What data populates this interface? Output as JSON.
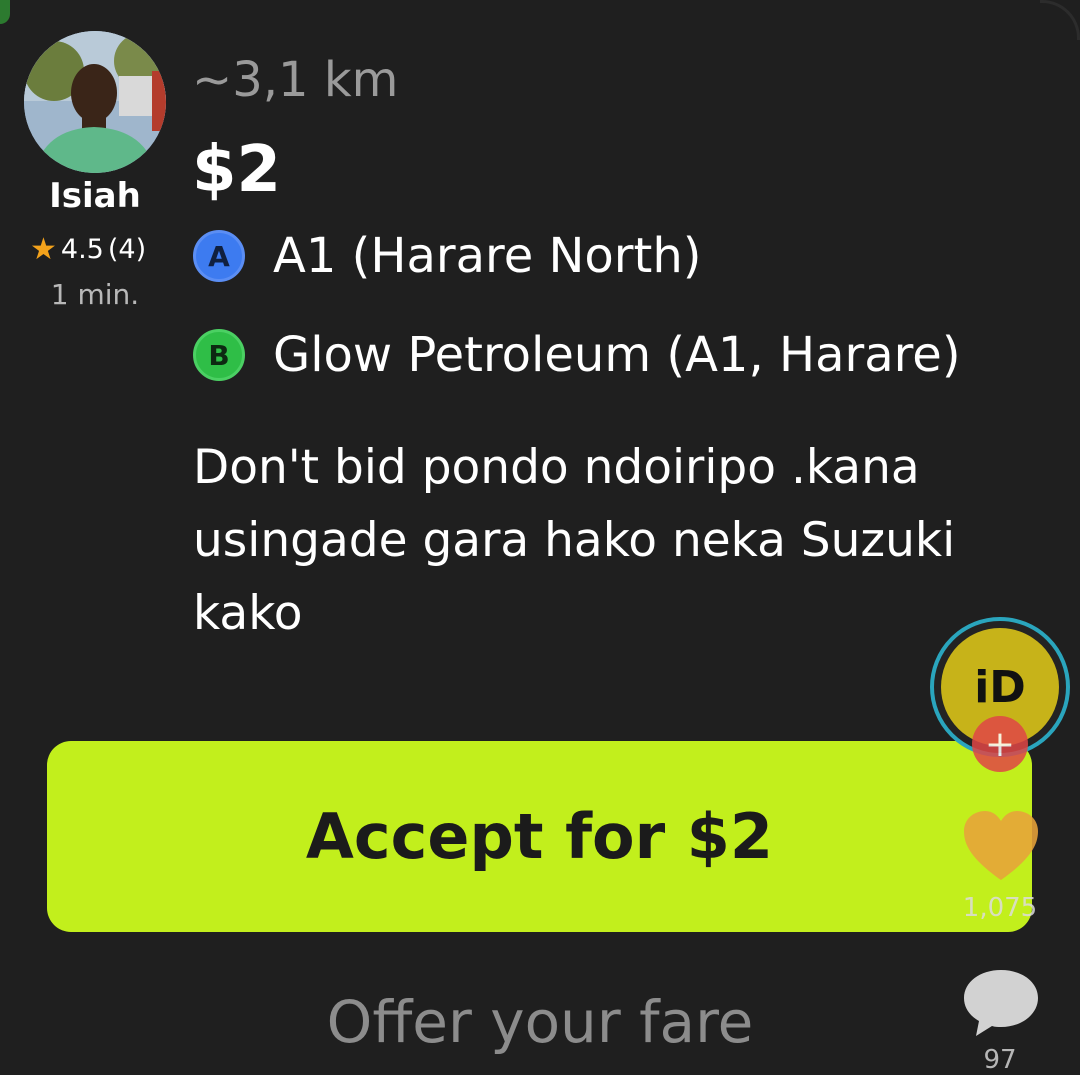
{
  "driver": {
    "name": "Isiah",
    "rating": "4.5",
    "rating_count": "(4)",
    "eta": "1 min."
  },
  "trip": {
    "distance": "~3,1 km",
    "price": "$2",
    "pickup_badge": "A",
    "pickup": "A1 (Harare North)",
    "dropoff_badge": "B",
    "dropoff": "Glow Petroleum (A1, Harare)",
    "comment": "Don't bid pondo ndoiripo .kana usingade gara hako neka Suzuki kako"
  },
  "actions": {
    "accept_label": "Accept for $2",
    "offer_label": "Offer your fare"
  },
  "overlay": {
    "profile_text": "iD",
    "follow_symbol": "+",
    "likes": "1,075",
    "comments": "97"
  },
  "colors": {
    "background": "#1f1f1f",
    "accept_button": "#c2ef1c",
    "badge_a": "#3d7bf0",
    "badge_b": "#2fbe47",
    "star": "#f3a21b",
    "heart": "#e8a33a"
  },
  "icons": {
    "rating": "star-icon",
    "like": "heart-icon",
    "comment": "comment-bubble-icon",
    "follow": "plus-icon"
  }
}
